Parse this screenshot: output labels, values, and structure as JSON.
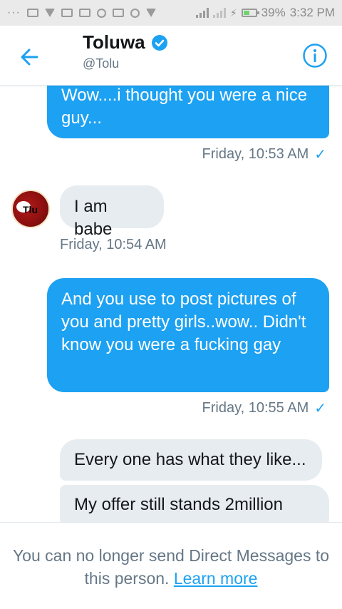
{
  "status_bar": {
    "battery": "39%",
    "time": "3:32 PM"
  },
  "header": {
    "display_name": "Toluwa",
    "handle": "@Tolu",
    "accent_color": "#1da1f2"
  },
  "messages": [
    {
      "direction": "outgoing",
      "text": "Wow....i thought you were a nice guy...",
      "timestamp": "Friday, 10:53 AM",
      "read": true
    },
    {
      "direction": "incoming",
      "text": "I am babe",
      "timestamp": "Friday, 10:54 AM"
    },
    {
      "direction": "outgoing",
      "text": "And you use to post pictures of you and pretty girls..wow.. Didn't know you were a fucking gay",
      "timestamp": "Friday, 10:55 AM",
      "read": true
    },
    {
      "direction": "incoming",
      "text": "Every one has what they like..."
    },
    {
      "direction": "incoming",
      "text": "My offer still stands 2million"
    }
  ],
  "avatar": {
    "text": "Tlu"
  },
  "footer": {
    "notice": "You can no longer send Direct Messages to this person.",
    "link": "Learn more"
  }
}
